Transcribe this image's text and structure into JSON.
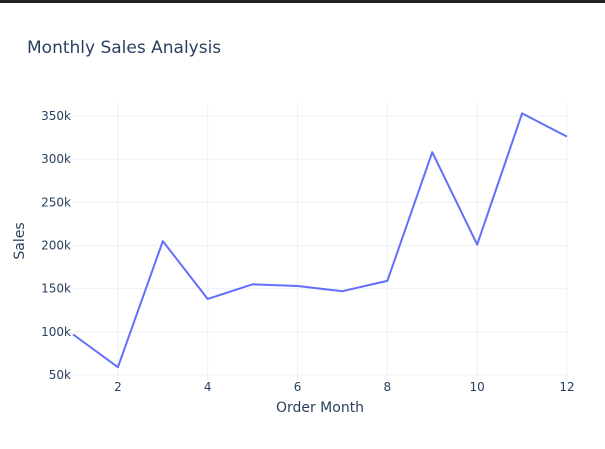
{
  "chart_data": {
    "type": "line",
    "title": "Monthly Sales Analysis",
    "xlabel": "Order Month",
    "ylabel": "Sales",
    "x": [
      1,
      2,
      3,
      4,
      5,
      6,
      7,
      8,
      9,
      10,
      11,
      12
    ],
    "series": [
      {
        "values": [
          97000,
          59000,
          205000,
          138000,
          155000,
          153000,
          147000,
          159000,
          308000,
          201000,
          353000,
          326000
        ]
      }
    ],
    "xlim": [
      1,
      12
    ],
    "ylim": [
      43000,
      365000
    ],
    "x_ticks": [
      2,
      4,
      6,
      8,
      10,
      12
    ],
    "y_ticks": [
      50000,
      100000,
      150000,
      200000,
      250000,
      300000,
      350000
    ],
    "x_tick_labels": [
      "2",
      "4",
      "6",
      "8",
      "10",
      "12"
    ],
    "y_tick_labels": [
      "50k",
      "100k",
      "150k",
      "200k",
      "250k",
      "300k",
      "350k"
    ],
    "grid": true,
    "line_color": "#636efa",
    "grid_color": "#ebf0f8",
    "text_color": "#2a3f5f"
  }
}
